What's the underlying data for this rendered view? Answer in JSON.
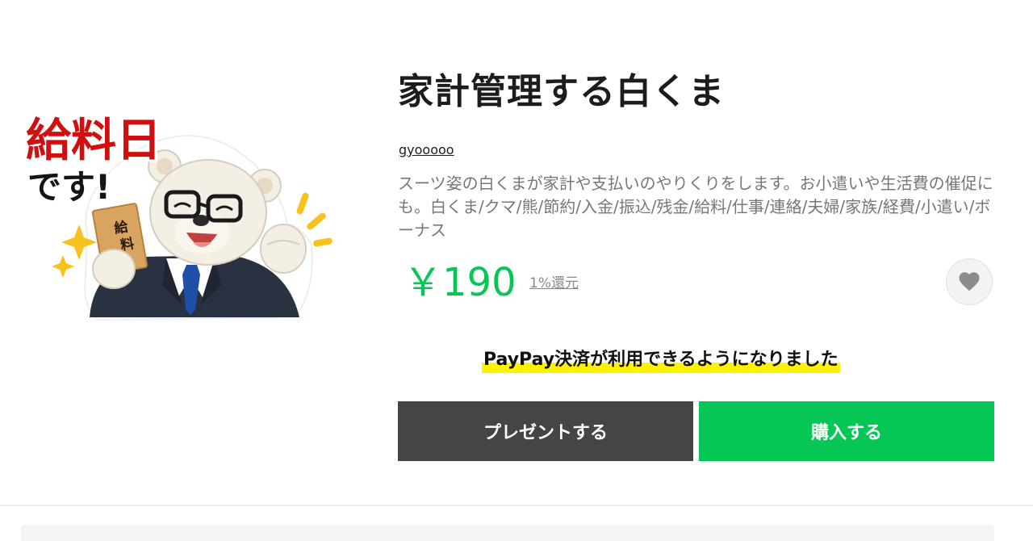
{
  "product": {
    "title": "家計管理する白くま",
    "author": "gyooooo",
    "description": "スーツ姿の白くまが家計や支払いのやりくりをします。お小遣いや生活費の催促にも。白くま/クマ/熊/節約/入金/振込/残金/給料/仕事/連絡/夫婦/家族/経費/小遣い/ボーナス",
    "price": "￥190",
    "cashback": "1%還元"
  },
  "sticker": {
    "caption_line1": "給料日",
    "caption_line2": "です!",
    "envelope_text": "給料",
    "colors": {
      "caption_red": "#d01010",
      "caption_black": "#141414",
      "suit": "#2a3140",
      "tie": "#1f4fa8",
      "fur": "#f4efe4",
      "envelope": "#d9a45f",
      "sparkle": "#f7c21b"
    }
  },
  "icons": {
    "like": "heart-icon"
  },
  "notice": {
    "text": "PayPay決済が利用できるようになりました"
  },
  "actions": {
    "gift_label": "プレゼントする",
    "buy_label": "購入する"
  },
  "colors": {
    "price_green": "#06c755",
    "buy_button": "#06c755",
    "gift_button": "#454545",
    "notice_highlight": "#fff200"
  }
}
